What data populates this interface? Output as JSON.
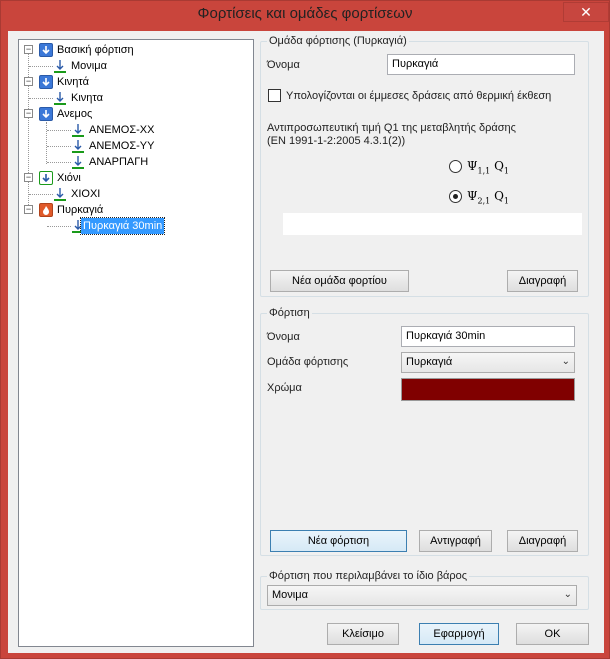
{
  "window": {
    "title": "Φορτίσεις και ομάδες φορτίσεων",
    "close_glyph": "✕"
  },
  "tree": {
    "groups": [
      {
        "label": "Βασική φόρτιση",
        "icon": "load-group-icon",
        "children": [
          "Μονιμα"
        ]
      },
      {
        "label": "Κινητά",
        "icon": "load-group-icon",
        "children": [
          "Κινητα"
        ]
      },
      {
        "label": "Ανεμος",
        "icon": "load-group-icon",
        "children": [
          "ΑΝΕΜΟΣ-ΧΧ",
          "ΑΝΕΜΟΣ-ΥΥ",
          "ΑΝΑΡΠΑΓΗ"
        ]
      },
      {
        "label": "Χιόνι",
        "icon": "load-group-icon",
        "children": [
          "ΧΙΟΧΙ"
        ]
      },
      {
        "label": "Πυρκαγιά",
        "icon": "fire-icon",
        "children": [
          "Πυρκαγιά 30min"
        ]
      }
    ],
    "selected": "Πυρκαγιά 30min"
  },
  "load_group": {
    "title": "Ομάδα φόρτισης (Πυρκαγιά)",
    "name_label": "Όνομα",
    "name_value": "Πυρκαγιά",
    "thermal_checkbox_label": "Υπολογίζονται οι έμμεσες δράσεις από θερμική έκθεση",
    "thermal_checked": false,
    "representative_text_1": "Αντιπροσωπευτική τιμή Q1 της μεταβλητής δράσης",
    "representative_text_2": "(EN 1991-1-2:2005 4.3.1(2))",
    "radio_psi11": "Ψ1,1 Q1",
    "radio_psi21": "Ψ2,1 Q1",
    "selected_radio": "psi21",
    "new_group_button": "Νέα ομάδα φορτίου",
    "delete_button": "Διαγραφή"
  },
  "load": {
    "title": "Φόρτιση",
    "name_label": "Όνομα",
    "name_value": "Πυρκαγιά 30min",
    "group_label": "Ομάδα φόρτισης",
    "group_value": "Πυρκαγιά",
    "color_label": "Χρώμα",
    "color_value": "#800000",
    "new_button": "Νέα φόρτιση",
    "copy_button": "Αντιγραφή",
    "delete_button": "Διαγραφή"
  },
  "self_weight": {
    "title": "Φόρτιση που περιλαμβάνει το ίδιο βάρος",
    "value": "Μονιμα"
  },
  "footer": {
    "close": "Κλείσιμο",
    "apply": "Εφαρμογή",
    "ok": "OK"
  }
}
